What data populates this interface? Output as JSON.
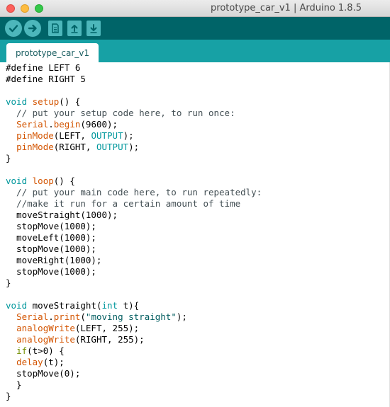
{
  "window": {
    "title": "prototype_car_v1 | Arduino 1.8.5"
  },
  "toolbar": {
    "buttons": [
      "verify",
      "upload",
      "new",
      "open",
      "save"
    ]
  },
  "tab": {
    "label": "prototype_car_v1"
  },
  "code_lines": [
    [
      {
        "t": "#define LEFT 6",
        "c": ""
      }
    ],
    [
      {
        "t": "#define RIGHT 5",
        "c": ""
      }
    ],
    [
      {
        "t": "",
        "c": ""
      }
    ],
    [
      {
        "t": "void",
        "c": "kw-type"
      },
      {
        "t": " ",
        "c": ""
      },
      {
        "t": "setup",
        "c": "kw-fn"
      },
      {
        "t": "() {",
        "c": ""
      }
    ],
    [
      {
        "t": "  // put your setup code here, to run once:",
        "c": "cm"
      }
    ],
    [
      {
        "t": "  ",
        "c": ""
      },
      {
        "t": "Serial",
        "c": "kw-fn"
      },
      {
        "t": ".",
        "c": ""
      },
      {
        "t": "begin",
        "c": "kw-fn"
      },
      {
        "t": "(9600);",
        "c": ""
      }
    ],
    [
      {
        "t": "  ",
        "c": ""
      },
      {
        "t": "pinMode",
        "c": "kw-fn"
      },
      {
        "t": "(LEFT, ",
        "c": ""
      },
      {
        "t": "OUTPUT",
        "c": "kw-const"
      },
      {
        "t": ");",
        "c": ""
      }
    ],
    [
      {
        "t": "  ",
        "c": ""
      },
      {
        "t": "pinMode",
        "c": "kw-fn"
      },
      {
        "t": "(RIGHT, ",
        "c": ""
      },
      {
        "t": "OUTPUT",
        "c": "kw-const"
      },
      {
        "t": ");",
        "c": ""
      }
    ],
    [
      {
        "t": "}",
        "c": ""
      }
    ],
    [
      {
        "t": "",
        "c": ""
      }
    ],
    [
      {
        "t": "void",
        "c": "kw-type"
      },
      {
        "t": " ",
        "c": ""
      },
      {
        "t": "loop",
        "c": "kw-fn"
      },
      {
        "t": "() {",
        "c": ""
      }
    ],
    [
      {
        "t": "  // put your main code here, to run repeatedly:",
        "c": "cm"
      }
    ],
    [
      {
        "t": "  //make it run for a certain amount of time",
        "c": "cm"
      }
    ],
    [
      {
        "t": "  moveStraight(1000);",
        "c": ""
      }
    ],
    [
      {
        "t": "  stopMove(1000);",
        "c": ""
      }
    ],
    [
      {
        "t": "  moveLeft(1000);",
        "c": ""
      }
    ],
    [
      {
        "t": "  stopMove(1000);",
        "c": ""
      }
    ],
    [
      {
        "t": "  moveRight(1000);",
        "c": ""
      }
    ],
    [
      {
        "t": "  stopMove(1000);",
        "c": ""
      }
    ],
    [
      {
        "t": "}",
        "c": ""
      }
    ],
    [
      {
        "t": "",
        "c": ""
      }
    ],
    [
      {
        "t": "void",
        "c": "kw-type"
      },
      {
        "t": " moveStraight(",
        "c": ""
      },
      {
        "t": "int",
        "c": "kw-type"
      },
      {
        "t": " t){",
        "c": ""
      }
    ],
    [
      {
        "t": "  ",
        "c": ""
      },
      {
        "t": "Serial",
        "c": "kw-fn"
      },
      {
        "t": ".",
        "c": ""
      },
      {
        "t": "print",
        "c": "kw-fn"
      },
      {
        "t": "(",
        "c": ""
      },
      {
        "t": "\"moving straight\"",
        "c": "str"
      },
      {
        "t": ");",
        "c": ""
      }
    ],
    [
      {
        "t": "  ",
        "c": ""
      },
      {
        "t": "analogWrite",
        "c": "kw-fn"
      },
      {
        "t": "(LEFT, 255);",
        "c": ""
      }
    ],
    [
      {
        "t": "  ",
        "c": ""
      },
      {
        "t": "analogWrite",
        "c": "kw-fn"
      },
      {
        "t": "(RIGHT, 255);",
        "c": ""
      }
    ],
    [
      {
        "t": "  ",
        "c": ""
      },
      {
        "t": "if",
        "c": "kw-ctrl"
      },
      {
        "t": "(t>0) {",
        "c": ""
      }
    ],
    [
      {
        "t": "  ",
        "c": ""
      },
      {
        "t": "delay",
        "c": "kw-fn"
      },
      {
        "t": "(t);",
        "c": ""
      }
    ],
    [
      {
        "t": "  stopMove(0);",
        "c": ""
      }
    ],
    [
      {
        "t": "  }",
        "c": ""
      }
    ],
    [
      {
        "t": "}",
        "c": ""
      }
    ]
  ]
}
